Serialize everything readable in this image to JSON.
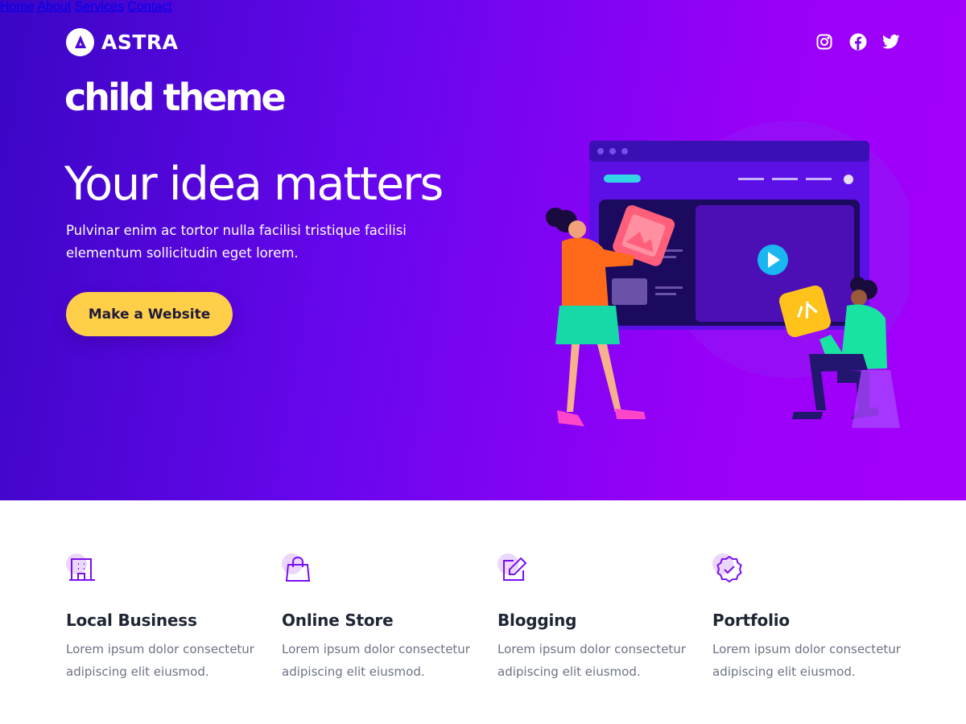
{
  "header": {
    "logo_text": "ASTRA",
    "nav": [
      "Home",
      "About",
      "Services",
      "Contact"
    ],
    "social_icons": [
      "instagram-icon",
      "facebook-icon",
      "twitter-icon"
    ]
  },
  "hero": {
    "child_theme_title": "child theme",
    "heading": "Your idea matters",
    "subtext": "Pulvinar enim ac tortor nulla facilisi tristique facilisi elementum sollicitudin eget lorem.",
    "cta_label": "Make a Website"
  },
  "features": [
    {
      "icon": "building-icon",
      "title": "Local Business",
      "text": "Lorem ipsum dolor consectetur adipiscing elit eiusmod."
    },
    {
      "icon": "shopping-bag-icon",
      "title": "Online Store",
      "text": "Lorem ipsum dolor consectetur adipiscing elit eiusmod."
    },
    {
      "icon": "edit-icon",
      "title": "Blogging",
      "text": "Lorem ipsum dolor consectetur adipiscing elit eiusmod."
    },
    {
      "icon": "badge-check-icon",
      "title": "Portfolio",
      "text": "Lorem ipsum dolor consectetur adipiscing elit eiusmod."
    }
  ],
  "colors": {
    "hero_gradient_start": "#3a06c4",
    "hero_gradient_end": "#a300fb",
    "cta_background": "#ffcf4a",
    "icon_accent": "#7a0ff2"
  }
}
